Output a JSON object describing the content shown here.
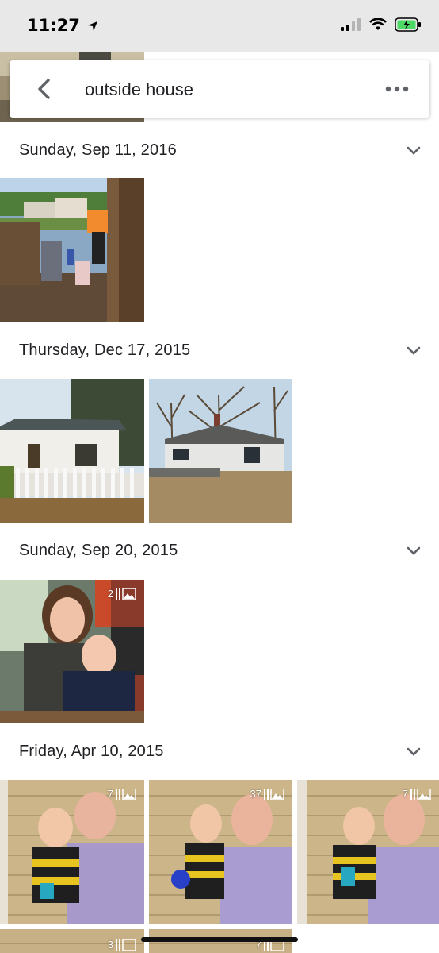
{
  "status": {
    "time": "11:27"
  },
  "search": {
    "query": "outside house"
  },
  "sections": [
    {
      "date": "Sunday, Sep 11, 2016"
    },
    {
      "date": "Thursday, Dec 17, 2015"
    },
    {
      "date": "Sunday, Sep 20, 2015"
    },
    {
      "date": "Friday, Apr 10, 2015"
    }
  ],
  "badges": {
    "sep20_photo1": "2",
    "apr10_photo1": "7",
    "apr10_photo2": "37",
    "apr10_photo3": "7",
    "row5_photo1": "3",
    "row5_photo2": "7"
  },
  "icons": [
    "location-arrow-icon",
    "signal-icon",
    "wifi-icon",
    "battery-icon",
    "back-arrow-icon",
    "more-icon",
    "chevron-down-icon",
    "burst-icon"
  ],
  "colors": {
    "status_bg": "#e8e8e8",
    "battery_fill": "#4cd964"
  }
}
